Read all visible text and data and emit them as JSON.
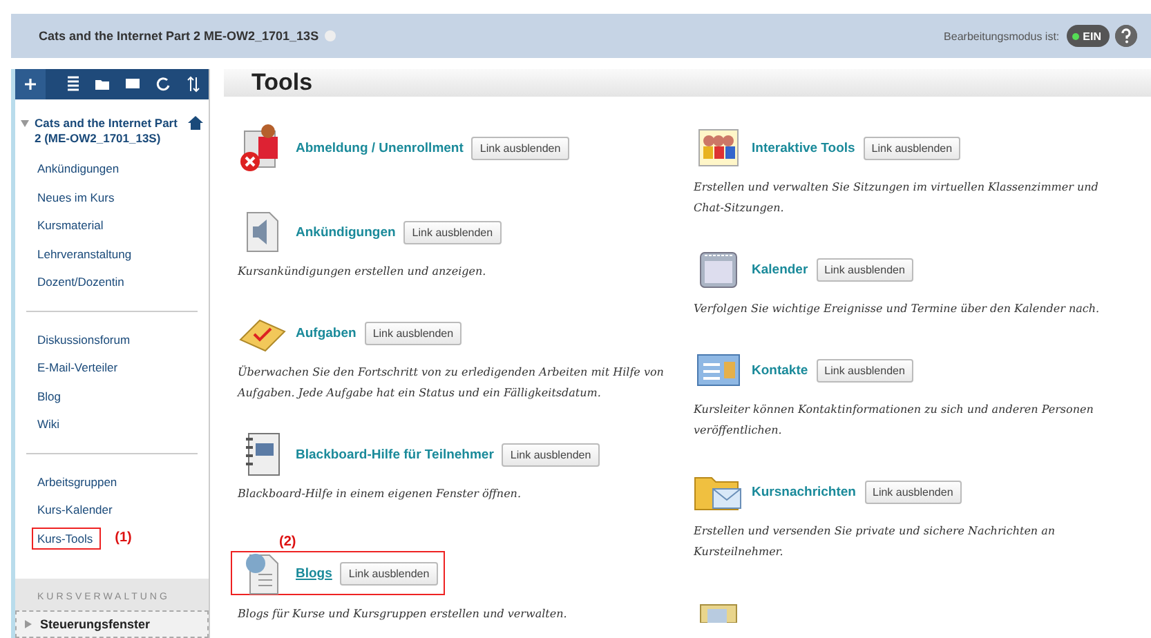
{
  "header": {
    "course_title": "Cats and the Internet Part 2 ME-OW2_1701_13S",
    "edit_mode_label": "Bearbeitungsmodus ist:",
    "edit_mode": {
      "label": "EIN",
      "on": true
    }
  },
  "sidebar": {
    "course": "Cats and the Internet Part 2 (ME-OW2_1701_13S)",
    "expanded": true,
    "groups": [
      {
        "items": [
          {
            "label": "Ankündigungen",
            "highlighted": false
          },
          {
            "label": "Neues im Kurs",
            "highlighted": false
          },
          {
            "label": "Kursmaterial",
            "highlighted": false
          },
          {
            "label": "Lehrveranstaltung",
            "highlighted": false
          },
          {
            "label": "Dozent/Dozentin",
            "highlighted": false
          }
        ]
      },
      {
        "items": [
          {
            "label": "Diskussionsforum",
            "highlighted": false
          },
          {
            "label": "E-Mail-Verteiler",
            "highlighted": false
          },
          {
            "label": "Blog",
            "highlighted": false
          },
          {
            "label": "Wiki",
            "highlighted": false
          }
        ]
      },
      {
        "items": [
          {
            "label": "Arbeitsgruppen",
            "highlighted": false
          },
          {
            "label": "Kurs-Kalender",
            "highlighted": false
          },
          {
            "label": "Kurs-Tools",
            "highlighted": true,
            "annotation": "(1)"
          }
        ]
      }
    ],
    "section_title": "KURSVERWALTUNG",
    "panel": {
      "label": "Steuerungsfenster",
      "expanded": false
    }
  },
  "page_title": "Tools",
  "columns": [
    [
      {
        "kind": "unenroll",
        "title": "Abmeldung / Unenrollment",
        "button": "Link ausblenden",
        "highlighted": false
      },
      {
        "kind": "announcement",
        "title": "Ankündigungen",
        "button": "Link ausblenden",
        "description": "Kursankündigungen erstellen und anzeigen.",
        "highlighted": false
      },
      {
        "kind": "assignment",
        "title": "Aufgaben",
        "button": "Link ausblenden",
        "description": "Überwachen Sie den Fortschritt von zu erledigenden Arbeiten mit Hilfe von Aufgaben. Jede Aufgabe hat ein Status und ein Fälligkeitsdatum.",
        "highlighted": false
      },
      {
        "kind": "help",
        "title": "Blackboard-Hilfe für Teilnehmer",
        "button": "Link ausblenden",
        "description": "Blackboard-Hilfe in einem eigenen Fenster öffnen.",
        "highlighted": false
      },
      {
        "kind": "blog",
        "title": "Blogs",
        "button": "Link ausblenden",
        "description": "Blogs für Kurse und Kursgruppen erstellen und verwalten.",
        "highlighted": true,
        "annotation": "(2)"
      }
    ],
    [
      {
        "kind": "people",
        "title": "Interaktive Tools",
        "button": "Link ausblenden",
        "description": "Erstellen und verwalten Sie Sitzungen im virtuellen Klassenzimmer und Chat-Sitzungen.",
        "highlighted": false
      },
      {
        "kind": "calendar",
        "title": "Kalender",
        "button": "Link ausblenden",
        "description": "Verfolgen Sie wichtige Ereignisse und Termine über den Kalender nach.",
        "highlighted": false
      },
      {
        "kind": "contact",
        "title": "Kontakte",
        "button": "Link ausblenden",
        "description": "Kursleiter können Kontaktinformationen zu sich und anderen Personen veröffentlichen.",
        "highlighted": false
      },
      {
        "kind": "message",
        "title": "Kursnachrichten",
        "button": "Link ausblenden",
        "description": "Erstellen und versenden Sie private und sichere Nachrichten an Kursteilnehmer.",
        "highlighted": false
      },
      {
        "kind": "grades"
      }
    ]
  ]
}
